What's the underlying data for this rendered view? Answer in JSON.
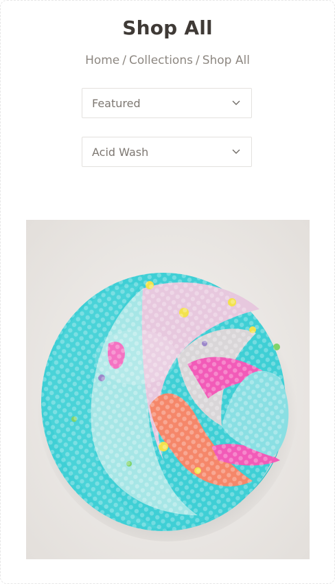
{
  "page": {
    "title": "Shop All"
  },
  "breadcrumb": {
    "items": [
      "Home",
      "Collections",
      "Shop All"
    ],
    "separator": "/"
  },
  "sort": {
    "selected": "Featured",
    "icon": "chevron-down-icon"
  },
  "filter": {
    "selected": "Acid Wash",
    "icon": "chevron-down-icon"
  },
  "product": {
    "image_alt": "Acid Wash handspun yarn skein",
    "colors": {
      "turquoise": "#35cfd6",
      "aqua": "#7fe0e2",
      "pink": "#f04fb0",
      "orange": "#f78a5a",
      "yellow": "#f2e04a",
      "lilac": "#b9a9e0",
      "background": "#eeebe8"
    }
  }
}
